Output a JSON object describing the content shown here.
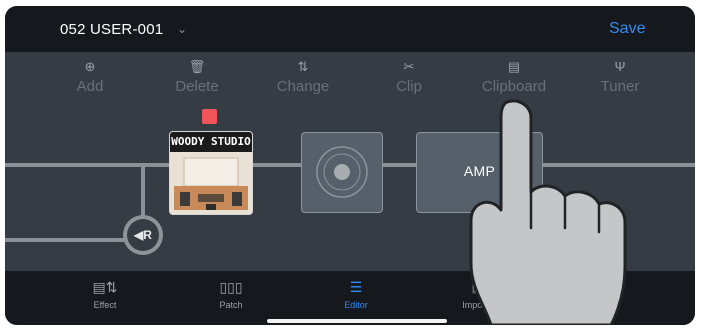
{
  "header": {
    "preset_name": "052 USER-001",
    "chevron_glyph": "⌄",
    "save_label": "Save"
  },
  "toolbar": {
    "items": [
      {
        "label": "Add",
        "icon": "plus-circle-icon",
        "glyph": "⊕"
      },
      {
        "label": "Delete",
        "icon": "trash-icon",
        "glyph": "🗑"
      },
      {
        "label": "Change",
        "icon": "swap-icon",
        "glyph": "⇅"
      },
      {
        "label": "Clip",
        "icon": "scissors-icon",
        "glyph": "✂"
      },
      {
        "label": "Clipboard",
        "icon": "clipboard-icon",
        "glyph": "▤"
      },
      {
        "label": "Tuner",
        "icon": "tuning-fork-icon",
        "glyph": "Ψ"
      }
    ]
  },
  "chain": {
    "effect_title": "WOODY STUDIO",
    "amp_label": "AMP",
    "return_label": "◀R"
  },
  "tabbar": {
    "tabs": [
      {
        "label": "Effect",
        "icon": "effect-icon",
        "glyph": "▤⇅",
        "active": false
      },
      {
        "label": "Patch",
        "icon": "patch-icon",
        "glyph": "▯▯▯",
        "active": false
      },
      {
        "label": "Editor",
        "icon": "editor-sliders-icon",
        "glyph": "☰",
        "active": true
      },
      {
        "label": "Import",
        "icon": "import-icon",
        "glyph": "⫼",
        "active": false
      }
    ]
  },
  "colors": {
    "accent": "#2e8dfb",
    "header_bg": "#15181c",
    "canvas_bg": "#363c44",
    "selection_marker": "#f2545b"
  }
}
